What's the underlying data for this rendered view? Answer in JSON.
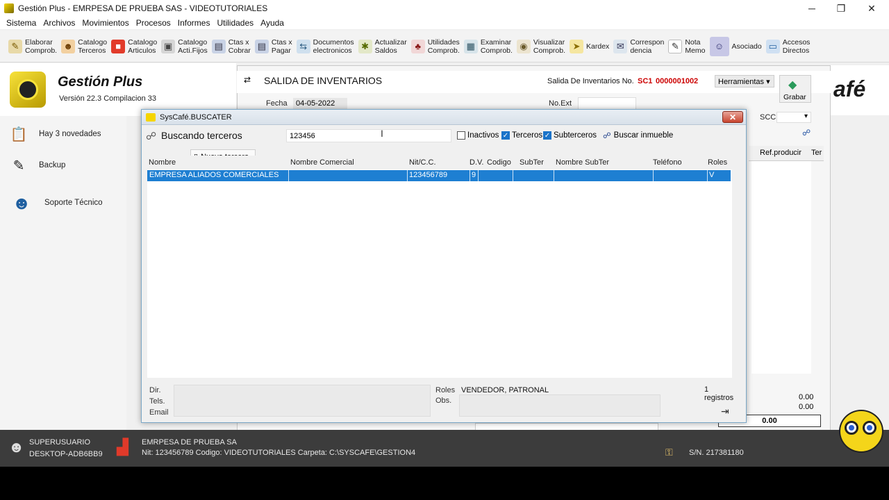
{
  "window": {
    "title": "Gestión Plus - EMRPESA DE PRUEBA SAS - VIDEOTUTORIALES"
  },
  "menu": [
    "Sistema",
    "Archivos",
    "Movimientos",
    "Procesos",
    "Informes",
    "Utilidades",
    "Ayuda"
  ],
  "toolbar": [
    {
      "label": "Elaborar\nComprob.",
      "icon": "edit-doc-icon"
    },
    {
      "label": "Catalogo\nTerceros",
      "icon": "person-icon"
    },
    {
      "label": "Catalogo\nArticulos",
      "icon": "box-icon"
    },
    {
      "label": "Catalogo\nActi.Fijos",
      "icon": "assets-icon"
    },
    {
      "label": "Ctas x\nCobrar",
      "icon": "receivable-icon"
    },
    {
      "label": "Ctas x\nPagar",
      "icon": "payable-icon"
    },
    {
      "label": "Documentos\nelectronicos",
      "icon": "edoc-icon"
    },
    {
      "label": "Actualizar\nSaldos",
      "icon": "refresh-icon"
    },
    {
      "label": "Utilidades\nComprob.",
      "icon": "tools-icon"
    },
    {
      "label": "Examinar\nComprob.",
      "icon": "examine-icon"
    },
    {
      "label": "Visualizar\nComprob.",
      "icon": "view-icon"
    },
    {
      "label": "Kardex",
      "icon": "kardex-icon"
    },
    {
      "label": "Correspon\ndencia",
      "icon": "mail-icon"
    },
    {
      "label": "Nota\nMemo",
      "icon": "note-icon"
    },
    {
      "label": "Asociado",
      "icon": "associate-icon"
    },
    {
      "label": "Accesos\nDirectos",
      "icon": "shortcuts-icon"
    }
  ],
  "app": {
    "name": "Gestión Plus",
    "version": "Versión 22.3  Compilacion 33"
  },
  "sidebar": [
    {
      "label": "Hay 3 novedades",
      "icon": "clipboard-icon"
    },
    {
      "label": "Backup",
      "icon": "backup-icon"
    },
    {
      "label": "Soporte Técnico",
      "icon": "support-icon"
    }
  ],
  "doc": {
    "title": "SALIDA DE INVENTARIOS",
    "number_label": "Salida De Inventarios No.",
    "prefix": "SC1",
    "number": "0000001002",
    "tools_label": "Herramientas",
    "save_label": "Grabar",
    "fecha_label": "Fecha",
    "fecha_value": "04-05-2022",
    "noext_label": "No.Ext",
    "scc_label": "SCC",
    "refprod_label": "Ref.producir",
    "ter_label": "Ter",
    "totals": [
      "0.00",
      "0.00",
      "0.00"
    ],
    "brand_fragment": "afé"
  },
  "dialog": {
    "title": "SysCafé.BUSCATER",
    "search_label": "Buscando terceros",
    "search_value": "123456",
    "inactivos": "Inactivos",
    "terceros": "Terceros",
    "subterceros": "Subterceros",
    "buscar_inmueble": "Buscar inmueble",
    "nuevo_tercero": "Nuevo tercero",
    "columns": [
      "Nombre",
      "Nombre Comercial",
      "Nit/C.C.",
      "D.V.",
      "Codigo",
      "SubTer",
      "Nombre SubTer",
      "Teléfono",
      "Roles"
    ],
    "rows": [
      {
        "nombre": "EMPRESA ALIADOS COMERCIALES",
        "comercial": "",
        "nit": "123456789",
        "dv": "9",
        "codigo": "",
        "subter": "",
        "nombre_subter": "",
        "telefono": "",
        "roles": "V"
      }
    ],
    "footer": {
      "dir": "Dir.",
      "tels": "Tels.",
      "email": "Email",
      "roles_label": "Roles",
      "roles_value": "VENDEDOR, PATRONAL",
      "obs": "Obs.",
      "count": "1 registros"
    }
  },
  "status": {
    "user": "SUPERUSUARIO",
    "machine": "DESKTOP-ADB6BB9",
    "company": "EMRPESA DE PRUEBA SA",
    "details": "Nit: 123456789  Codigo: VIDEOTUTORIALES   Carpeta: C:\\SYSCAFE\\GESTION4",
    "serial": "S/N. 217381180"
  }
}
